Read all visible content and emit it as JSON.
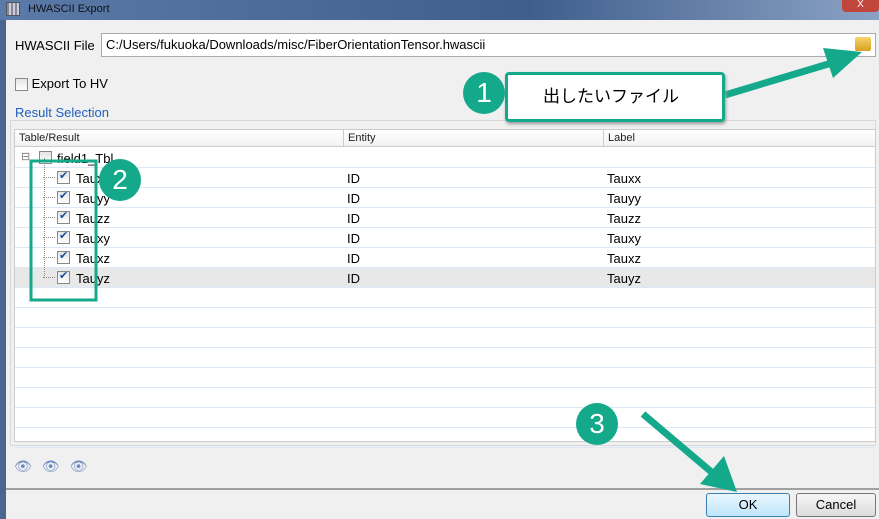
{
  "window": {
    "title": "HWASCII Export",
    "close_label": "X"
  },
  "file": {
    "label": "HWASCII File",
    "value": "C:/Users/fukuoka/Downloads/misc/FiberOrientationTensor.hwascii",
    "browse_icon": "folder-open-icon"
  },
  "export_to_hv": {
    "label": "Export To HV",
    "checked": false
  },
  "result_selection": {
    "title": "Result Selection",
    "columns": [
      "Table/Result",
      "Entity",
      "Label"
    ],
    "parent": {
      "name": "field1_Tbl",
      "checked": false
    },
    "rows": [
      {
        "name": "Tauxx",
        "entity": "ID",
        "label": "Tauxx",
        "checked": true
      },
      {
        "name": "Tauyy",
        "entity": "ID",
        "label": "Tauyy",
        "checked": true
      },
      {
        "name": "Tauzz",
        "entity": "ID",
        "label": "Tauzz",
        "checked": true
      },
      {
        "name": "Tauxy",
        "entity": "ID",
        "label": "Tauxy",
        "checked": true
      },
      {
        "name": "Tauxz",
        "entity": "ID",
        "label": "Tauxz",
        "checked": true
      },
      {
        "name": "Tauyz",
        "entity": "ID",
        "label": "Tauyz",
        "checked": true
      }
    ]
  },
  "toolbar_icons": [
    "show-all-selected-icon",
    "show-none-selected-icon",
    "reverse-selection-icon"
  ],
  "buttons": {
    "ok": "OK",
    "cancel": "Cancel"
  },
  "annotations": {
    "step1": "1",
    "callout1": "出したいファイル",
    "step2": "2",
    "step3": "3",
    "color": "#13a98a"
  }
}
